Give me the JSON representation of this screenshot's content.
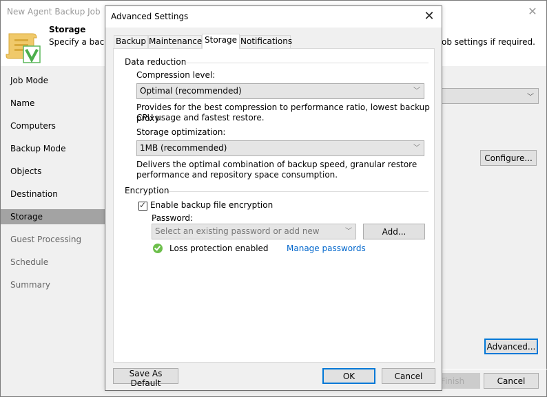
{
  "wizard": {
    "title": "New Agent Backup Job",
    "header": {
      "title": "Storage",
      "description_left": "Specify a backu",
      "description_right": "ob settings if required."
    },
    "nav": [
      {
        "label": "Job Mode",
        "state": "enabled"
      },
      {
        "label": "Name",
        "state": "enabled"
      },
      {
        "label": "Computers",
        "state": "enabled"
      },
      {
        "label": "Backup Mode",
        "state": "enabled"
      },
      {
        "label": "Objects",
        "state": "enabled"
      },
      {
        "label": "Destination",
        "state": "enabled"
      },
      {
        "label": "Storage",
        "state": "active"
      },
      {
        "label": "Guest Processing",
        "state": "disabled"
      },
      {
        "label": "Schedule",
        "state": "disabled"
      },
      {
        "label": "Summary",
        "state": "disabled"
      }
    ],
    "buttons": {
      "configure": "Configure...",
      "advanced": "Advanced...",
      "finish": "Finish",
      "cancel": "Cancel"
    }
  },
  "dialog": {
    "title": "Advanced Settings",
    "tabs": [
      "Backup",
      "Maintenance",
      "Storage",
      "Notifications"
    ],
    "active_tab": "Storage",
    "data_reduction": {
      "group_label": "Data reduction",
      "compression_label": "Compression level:",
      "compression_value": "Optimal (recommended)",
      "compression_desc_1": "Provides for the best compression to performance ratio, lowest backup proxy",
      "compression_desc_2": "CPU usage and fastest restore.",
      "optimization_label": "Storage optimization:",
      "optimization_value": "1MB (recommended)",
      "optimization_desc_1": "Delivers the optimal combination of backup speed, granular restore",
      "optimization_desc_2": "performance and repository space consumption."
    },
    "encryption": {
      "group_label": "Encryption",
      "enable_label": "Enable backup file encryption",
      "enabled": true,
      "password_label": "Password:",
      "password_placeholder": "Select an existing password or add new",
      "add_button": "Add...",
      "status_text": "Loss protection enabled",
      "manage_link": "Manage passwords"
    },
    "buttons": {
      "save_default": "Save As Default",
      "ok": "OK",
      "cancel": "Cancel"
    }
  },
  "colors": {
    "accent": "#0078d7",
    "link": "#0066cc",
    "success": "#6dbf4b",
    "nav_active": "#a3a3a3"
  }
}
